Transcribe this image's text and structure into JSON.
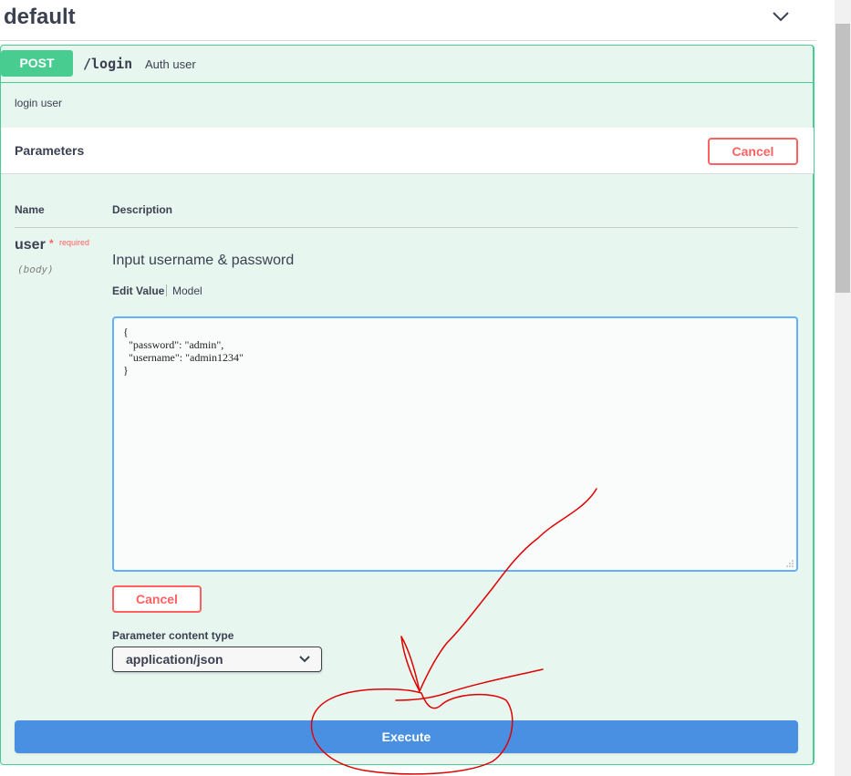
{
  "tag": {
    "title": "default",
    "toggle_icon": "chevron-down-icon"
  },
  "operation": {
    "method": "POST",
    "path": "/login",
    "summary": "Auth user",
    "description": "login user",
    "accent_color": "#49cc90",
    "background_color": "#e8f6f0"
  },
  "parameters": {
    "title": "Parameters",
    "cancel_label": "Cancel",
    "columns": {
      "name": "Name",
      "description": "Description"
    },
    "items": [
      {
        "name": "user",
        "required_mark": "*",
        "required_label": "required",
        "in": "(body)",
        "description": "Input username & password",
        "tabs": {
          "edit_value": "Edit Value",
          "model": "Model"
        },
        "value": "{\n  \"password\": \"admin\",\n  \"username\": \"admin1234\"\n}"
      }
    ],
    "body_cancel_label": "Cancel",
    "content_type_label": "Parameter content type",
    "content_type_value": "application/json",
    "content_type_options": [
      "application/json"
    ]
  },
  "execute": {
    "label": "Execute",
    "color": "#4990e2"
  },
  "annotation": {
    "color": "#e00000",
    "shapes": [
      "freehand-arrow",
      "freehand-circle"
    ]
  }
}
